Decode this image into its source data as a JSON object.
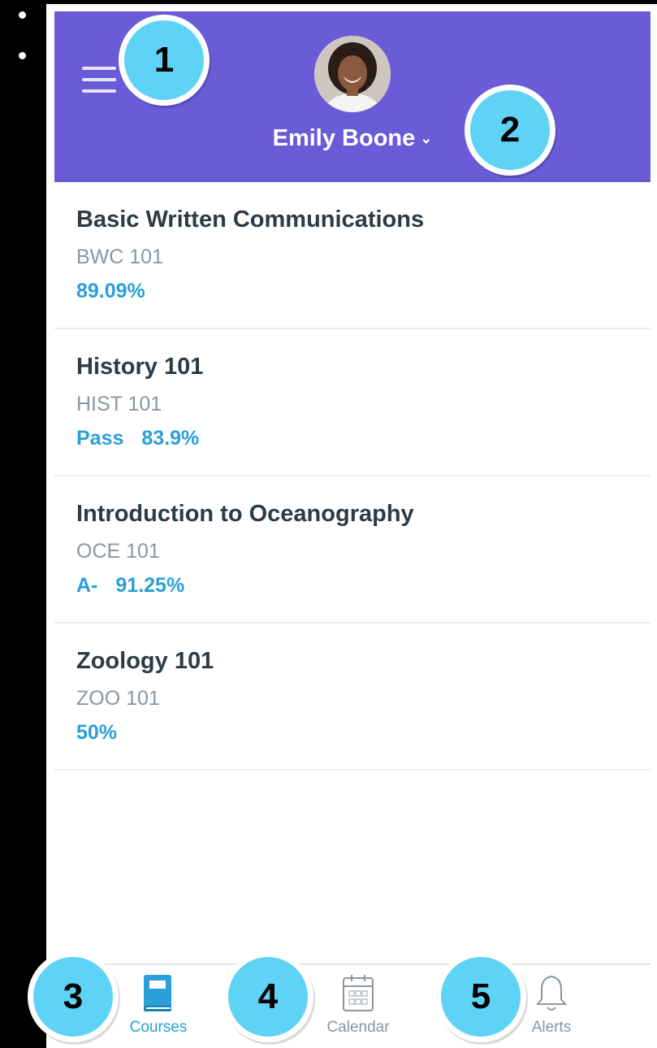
{
  "header": {
    "user_name": "Emily Boone",
    "background_color": "#6c5bd6"
  },
  "courses": [
    {
      "title": "Basic Written Communications",
      "code": "BWC 101",
      "grade_letter": "",
      "grade_percent": "89.09%"
    },
    {
      "title": "History 101",
      "code": "HIST 101",
      "grade_letter": "Pass",
      "grade_percent": "83.9%"
    },
    {
      "title": "Introduction to Oceanography",
      "code": "OCE 101",
      "grade_letter": "A-",
      "grade_percent": "91.25%"
    },
    {
      "title": "Zoology 101",
      "code": "ZOO 101",
      "grade_letter": "",
      "grade_percent": "50%"
    }
  ],
  "tabs": [
    {
      "label": "Courses",
      "icon": "book-icon",
      "active": true
    },
    {
      "label": "Calendar",
      "icon": "calendar-icon",
      "active": false
    },
    {
      "label": "Alerts",
      "icon": "bell-icon",
      "active": false
    }
  ],
  "callouts": {
    "c1": "1",
    "c2": "2",
    "c3": "3",
    "c4": "4",
    "c5": "5"
  },
  "colors": {
    "accent": "#2a9fd8",
    "callout": "#5ed3f5"
  }
}
